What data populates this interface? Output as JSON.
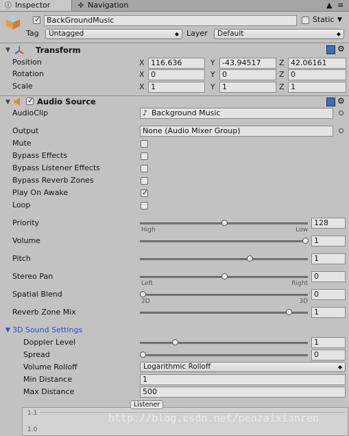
{
  "tabs": [
    {
      "label": "Inspector",
      "icon": "info-icon"
    },
    {
      "label": "Navigation",
      "icon": "navigation-icon"
    }
  ],
  "object": {
    "name": "BackGroundMusic",
    "active": true,
    "static_label": "Static",
    "static": false,
    "tag_label": "Tag",
    "tag_value": "Untagged",
    "layer_label": "Layer",
    "layer_value": "Default"
  },
  "transform": {
    "title": "Transform",
    "axes": [
      "X",
      "Y",
      "Z"
    ],
    "rows": [
      {
        "label": "Position",
        "x": "116.636",
        "y": "-43.94517",
        "z": "42.06161"
      },
      {
        "label": "Rotation",
        "x": "0",
        "y": "0",
        "z": "0"
      },
      {
        "label": "Scale",
        "x": "1",
        "y": "1",
        "z": "1"
      }
    ]
  },
  "audio": {
    "title": "Audio Source",
    "enabled": true,
    "clip_label": "AudioClip",
    "clip_value": "Background Music",
    "output_label": "Output",
    "output_value": "None (Audio Mixer Group)",
    "toggles": [
      {
        "label": "Mute",
        "checked": false
      },
      {
        "label": "Bypass Effects",
        "checked": false
      },
      {
        "label": "Bypass Listener Effects",
        "checked": false
      },
      {
        "label": "Bypass Reverb Zones",
        "checked": false
      },
      {
        "label": "Play On Awake",
        "checked": true
      },
      {
        "label": "Loop",
        "checked": false
      }
    ],
    "sliders": [
      {
        "label": "Priority",
        "value": "128",
        "fraction": 0.5,
        "left": "High",
        "right": "Low"
      },
      {
        "label": "Volume",
        "value": "1",
        "fraction": 1.0
      },
      {
        "label": "Pitch",
        "value": "1",
        "fraction": 0.66
      },
      {
        "label": "Stereo Pan",
        "value": "0",
        "fraction": 0.5,
        "left": "Left",
        "right": "Right"
      },
      {
        "label": "Spatial Blend",
        "value": "0",
        "fraction": 0.0,
        "left": "2D",
        "right": "3D"
      },
      {
        "label": "Reverb Zone Mix",
        "value": "1",
        "fraction": 0.9
      }
    ],
    "sound3d": {
      "title": "3D Sound Settings",
      "doppler_label": "Doppler Level",
      "doppler_value": "1",
      "doppler_fraction": 0.2,
      "spread_label": "Spread",
      "spread_value": "0",
      "spread_fraction": 0.0,
      "rolloff_label": "Volume Rolloff",
      "rolloff_value": "Logarithmic Rolloff",
      "min_label": "Min Distance",
      "min_value": "1",
      "max_label": "Max Distance",
      "max_value": "500"
    },
    "graph": {
      "listener_label": "Listener",
      "tick_top": "1.1",
      "tick_next": "1.0"
    }
  },
  "watermark": "http://blog.csdn.net/penzaixianren"
}
